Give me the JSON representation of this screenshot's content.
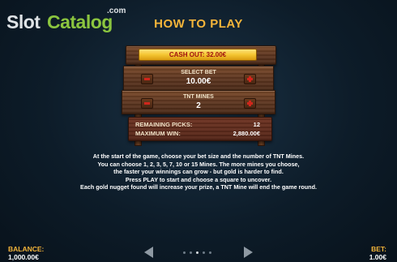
{
  "logo": {
    "slot": "Slot",
    "catalog": "Catalog",
    "com": ".com"
  },
  "title": "HOW TO PLAY",
  "cashout": {
    "label": "CASH OUT: 32.00€"
  },
  "select_bet": {
    "label": "SELECT BET",
    "value": "10.00€"
  },
  "tnt_mines": {
    "label": "TNT MINES",
    "value": "2"
  },
  "stats": {
    "remaining_label": "REMAINING PICKS:",
    "remaining_value": "12",
    "max_win_label": "MAXIMUM WIN:",
    "max_win_value": "2,880.00€"
  },
  "instructions": [
    "At the start of the game, choose your bet size and the number of TNT Mines.",
    "You can choose 1, 2, 3, 5, 7, 10 or 15 Mines. The more mines you choose,",
    "the faster your winnings can grow - but gold is harder to find.",
    "Press PLAY to start and choose a square to uncover.",
    "Each gold nugget found will increase your prize, a TNT Mine will end the game round."
  ],
  "footer": {
    "balance_label": "BALANCE:",
    "balance_value": "1,000.00€",
    "bet_label": "BET:",
    "bet_value": "1.00€",
    "page_count": 5,
    "active_page": 2
  },
  "colors": {
    "accent": "#f5b53a",
    "logo_green": "#8bc53f",
    "minus_plus_red": "#d0261c",
    "cashout_text": "#a01010"
  },
  "icons": {
    "prev": "chevron-left-icon",
    "next": "chevron-right-icon",
    "minus": "minus-icon",
    "plus": "plus-icon"
  }
}
